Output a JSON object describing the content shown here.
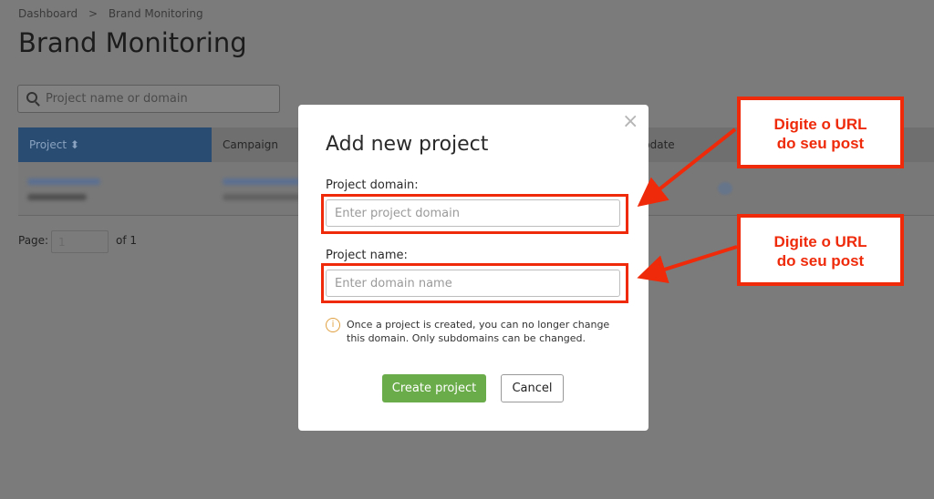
{
  "breadcrumb": {
    "items": [
      "Dashboard",
      "Brand Monitoring"
    ],
    "separator": ">"
  },
  "page_title": "Brand Monitoring",
  "search": {
    "placeholder": "Project name or domain"
  },
  "table": {
    "columns": [
      "Project",
      "Campaign",
      "Last update"
    ],
    "visible_update_label": "pdate"
  },
  "pager": {
    "label": "Page:",
    "value": "1",
    "of": "of 1"
  },
  "modal": {
    "title": "Add new project",
    "close": "×",
    "domain_label": "Project domain:",
    "domain_placeholder": "Enter project domain",
    "name_label": "Project name:",
    "name_placeholder": "Enter domain name",
    "info_icon": "i",
    "info_text": "Once a project is created, you can no longer change this domain. Only subdomains can be changed.",
    "create_label": "Create project",
    "cancel_label": "Cancel"
  },
  "annotations": [
    {
      "text1": "Digite o URL",
      "text2": "do seu post"
    },
    {
      "text1": "Digite o URL",
      "text2": "do seu post"
    }
  ],
  "colors": {
    "accent_red": "#ee2a0a",
    "create_green": "#6aab4a",
    "header_blue": "#294c72"
  }
}
